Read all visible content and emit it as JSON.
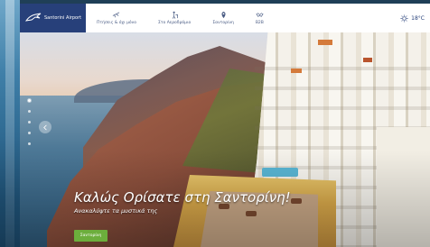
{
  "header": {
    "logo_text": "Santorini Airport",
    "nav": [
      {
        "label": "Πτήσεις & όχι μόνο",
        "icon": "plane-icon"
      },
      {
        "label": "Στο Αεροδρόμιο",
        "icon": "traveler-icon"
      },
      {
        "label": "Σαντορίνη",
        "icon": "location-pin-icon"
      },
      {
        "label": "B2B",
        "icon": "handshake-icon"
      }
    ],
    "weather": {
      "temp": "18°C",
      "icon": "sun-icon"
    }
  },
  "hero": {
    "title": "Καλώς Ορίσατε στη Σαντορίνη!",
    "subtitle": "Ανακαλύψτε τα μυστικά της",
    "cta_label": "Σαντορίνη",
    "slide_count": 5,
    "active_slide": 1
  },
  "colors": {
    "brand_navy": "#27407a",
    "nav_text": "#4a5c84",
    "cta_green": "#6cae3c"
  }
}
